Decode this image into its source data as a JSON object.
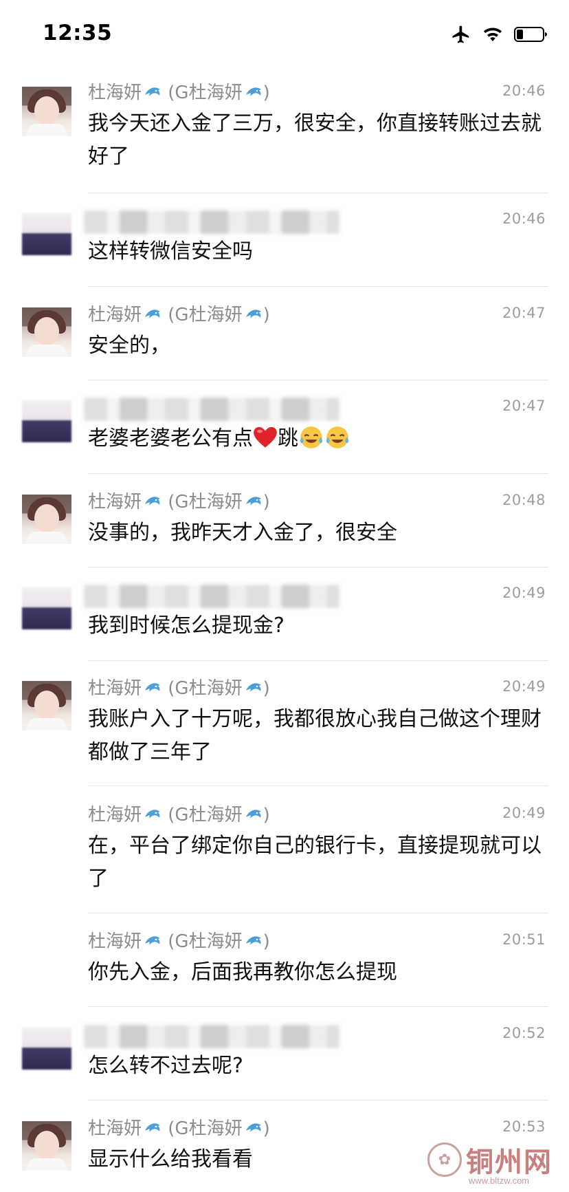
{
  "status_bar": {
    "time": "12:35",
    "icons": [
      "airplane-mode-icon",
      "wifi-icon",
      "battery-icon"
    ]
  },
  "messages": [
    {
      "sender": "杜海妍",
      "sender_suffix": "(G杜海妍",
      "sender_close": ")",
      "time": "20:46",
      "text": "我今天还入金了三万，很安全，你直接转账过去就好了",
      "avatar": "woman"
    },
    {
      "sender": "",
      "time": "20:46",
      "text": "这样转微信安全吗",
      "avatar": "blurred"
    },
    {
      "sender": "杜海妍",
      "sender_suffix": "(G杜海妍",
      "sender_close": ")",
      "time": "20:47",
      "text": "安全的，",
      "avatar": "woman"
    },
    {
      "sender": "",
      "time": "20:47",
      "text_before": "老婆老婆老公有点",
      "text_after": "跳",
      "emojis": [
        "heart-emoji",
        "crying-laughing-emoji",
        "crying-laughing-emoji"
      ],
      "avatar": "blurred"
    },
    {
      "sender": "杜海妍",
      "sender_suffix": "(G杜海妍",
      "sender_close": ")",
      "time": "20:48",
      "text": "没事的，我昨天才入金了，很安全",
      "avatar": "woman"
    },
    {
      "sender": "",
      "time": "20:49",
      "text": "我到时候怎么提现金?",
      "avatar": "blurred"
    },
    {
      "sender": "杜海妍",
      "sender_suffix": "(G杜海妍",
      "sender_close": ")",
      "time": "20:49",
      "text": "我账户入了十万呢，我都很放心我自己做这个理财都做了三年了",
      "avatar": "woman"
    },
    {
      "sender": "杜海妍",
      "sender_suffix": "(G杜海妍",
      "sender_close": ")",
      "time": "20:49",
      "text": "在，平台了绑定你自己的银行卡，直接提现就可以了",
      "avatar": "none"
    },
    {
      "sender": "杜海妍",
      "sender_suffix": "(G杜海妍",
      "sender_close": ")",
      "time": "20:51",
      "text": "你先入金，后面我再教你怎么提现",
      "avatar": "none"
    },
    {
      "sender": "",
      "time": "20:52",
      "text": "怎么转不过去呢?",
      "avatar": "blurred"
    },
    {
      "sender": "杜海妍",
      "sender_suffix": "(G杜海妍",
      "sender_close": ")",
      "time": "20:53",
      "text": "显示什么给我看看",
      "avatar": "woman"
    }
  ],
  "watermark": {
    "name": "铜州网",
    "url": "www.bltzw.com"
  }
}
